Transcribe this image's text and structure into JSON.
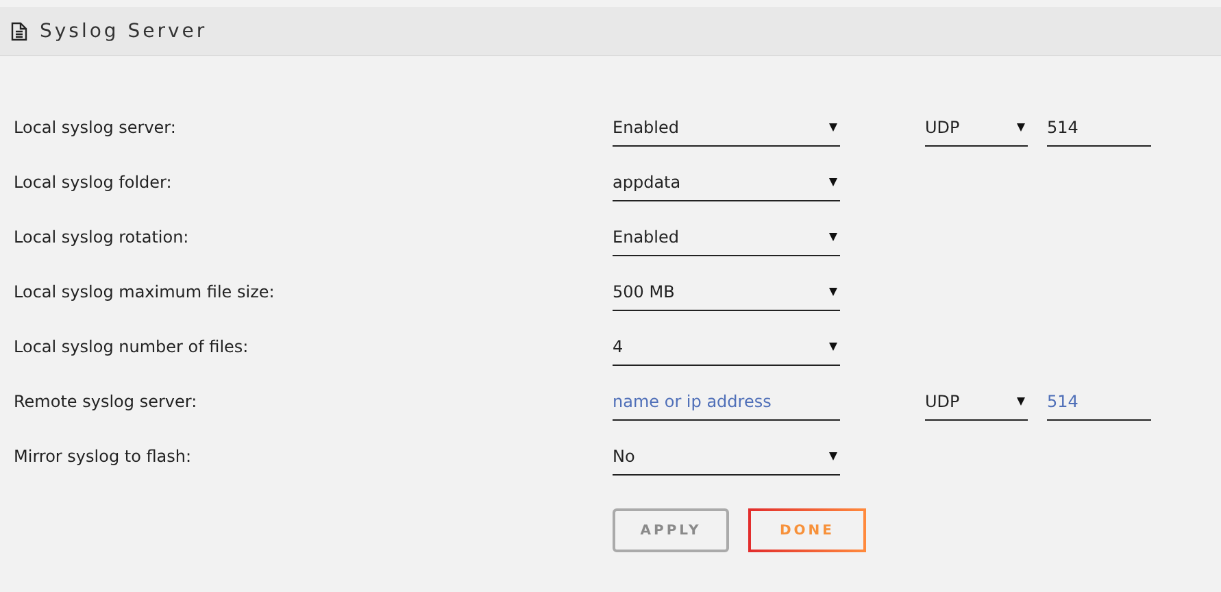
{
  "panel": {
    "title": "Syslog Server"
  },
  "rows": [
    {
      "label": "Local syslog server:",
      "controls": [
        {
          "kind": "select",
          "value": "Enabled"
        },
        {
          "kind": "select",
          "value": "UDP"
        },
        {
          "kind": "input",
          "value": "514"
        }
      ]
    },
    {
      "label": "Local syslog folder:",
      "controls": [
        {
          "kind": "select",
          "value": "appdata"
        }
      ]
    },
    {
      "label": "Local syslog rotation:",
      "controls": [
        {
          "kind": "select",
          "value": "Enabled"
        }
      ]
    },
    {
      "label": "Local syslog maximum file size:",
      "controls": [
        {
          "kind": "select",
          "value": "500 MB"
        }
      ]
    },
    {
      "label": "Local syslog number of files:",
      "controls": [
        {
          "kind": "select",
          "value": "4"
        }
      ]
    },
    {
      "label": "Remote syslog server:",
      "controls": [
        {
          "kind": "input",
          "placeholder": "name or ip address"
        },
        {
          "kind": "select",
          "value": "UDP"
        },
        {
          "kind": "input",
          "placeholder": "514"
        }
      ]
    },
    {
      "label": "Mirror syslog to flash:",
      "controls": [
        {
          "kind": "select",
          "value": "No"
        }
      ]
    }
  ],
  "buttons": [
    {
      "label": "APPLY",
      "kind": "apply",
      "disabled": true
    },
    {
      "label": "DONE",
      "kind": "done",
      "disabled": false
    }
  ]
}
